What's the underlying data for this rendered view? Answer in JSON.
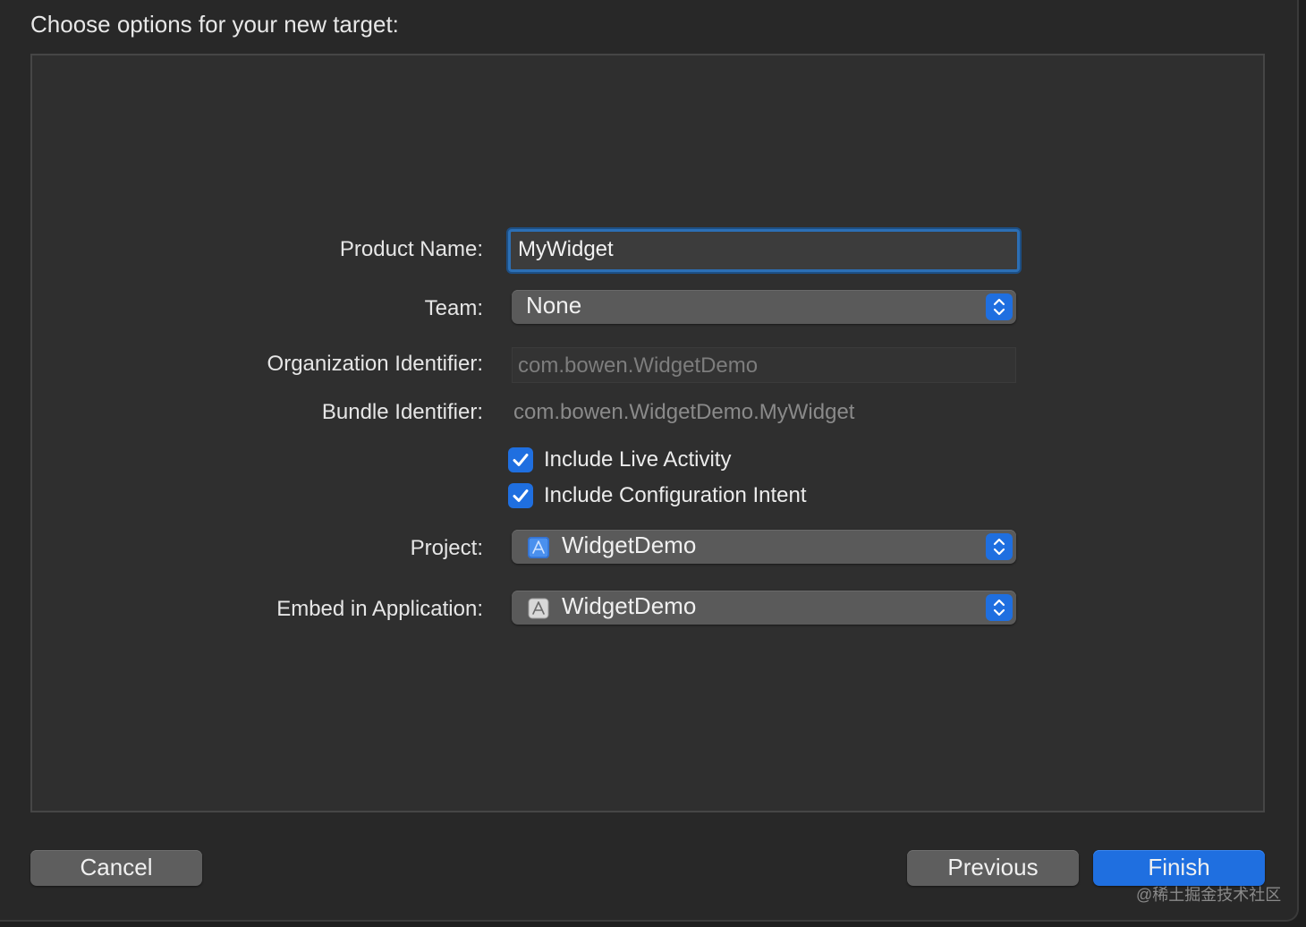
{
  "header": {
    "title": "Choose options for your new target:"
  },
  "form": {
    "product_name": {
      "label": "Product Name:",
      "value": "MyWidget"
    },
    "team": {
      "label": "Team:",
      "value": "None"
    },
    "organization_identifier": {
      "label": "Organization Identifier:",
      "value": "com.bowen.WidgetDemo"
    },
    "bundle_identifier": {
      "label": "Bundle Identifier:",
      "value": "com.bowen.WidgetDemo.MyWidget"
    },
    "include_live_activity": {
      "label": "Include Live Activity",
      "checked": true
    },
    "include_configuration_intent": {
      "label": "Include Configuration Intent",
      "checked": true
    },
    "project": {
      "label": "Project:",
      "value": "WidgetDemo",
      "icon": "xcode-project-icon"
    },
    "embed_in_application": {
      "label": "Embed in Application:",
      "value": "WidgetDemo",
      "icon": "app-icon"
    }
  },
  "footer": {
    "cancel_label": "Cancel",
    "previous_label": "Previous",
    "finish_label": "Finish"
  },
  "watermark": "@稀土掘金技术社区",
  "colors": {
    "accent": "#1f6fe0",
    "focus_ring": "#2c6fb5",
    "window_bg": "#282828",
    "panel_bg": "#2f2f2f"
  }
}
